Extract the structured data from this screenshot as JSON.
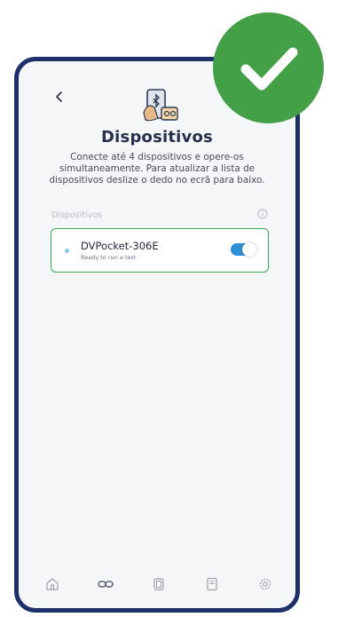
{
  "header": {
    "title": "Dispositivos",
    "subtitle": "Conecte até 4 dispositivos e opere-os simultaneamente. Para atualizar a lista de dispositivos deslize o dedo no ecrã para baixo."
  },
  "devices_section": {
    "label": "Dispositivos",
    "info_icon": "info-icon"
  },
  "devices": [
    {
      "name": "DVPocket-306E",
      "status": "Ready to run a test",
      "enabled": true
    }
  ],
  "bottom_nav": {
    "items": [
      {
        "icon": "home-icon"
      },
      {
        "icon": "link-icon"
      },
      {
        "icon": "device-icon"
      },
      {
        "icon": "document-icon"
      },
      {
        "icon": "settings-icon"
      }
    ]
  },
  "overlay": {
    "badge_icon": "checkmark-icon",
    "badge_color": "#43a047"
  },
  "colors": {
    "frame": "#1f2f6a",
    "accent": "#2f8fd6",
    "card_border": "#3aaa58"
  }
}
